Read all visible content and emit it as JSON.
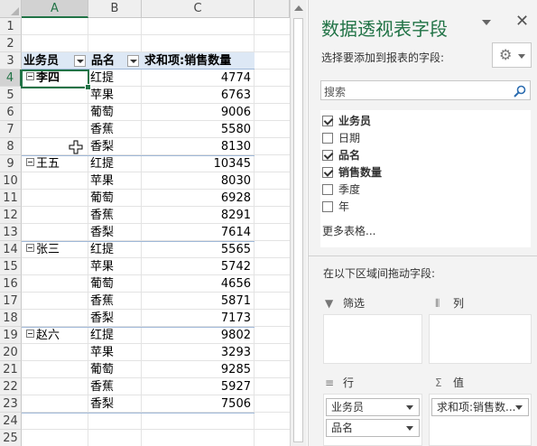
{
  "spreadsheet": {
    "columns": [
      "A",
      "B",
      "C"
    ],
    "selected_column": "A",
    "selected_row": "4",
    "row_numbers": [
      "1",
      "2",
      "3",
      "4",
      "5",
      "6",
      "7",
      "8",
      "9",
      "10",
      "11",
      "12",
      "13",
      "14",
      "15",
      "16",
      "17",
      "18",
      "19",
      "20",
      "21",
      "22",
      "23",
      "24",
      "25"
    ],
    "pivot_headers": {
      "a": "业务员",
      "b": "品名",
      "c": "求和项:销售数量"
    },
    "salespeople": [
      "李四",
      "王五",
      "张三",
      "赵六"
    ],
    "products": [
      "红提",
      "苹果",
      "葡萄",
      "香蕉",
      "香梨",
      "红提",
      "苹果",
      "葡萄",
      "香蕉",
      "香梨",
      "红提",
      "苹果",
      "葡萄",
      "香蕉",
      "香梨",
      "红提",
      "苹果",
      "葡萄",
      "香蕉",
      "香梨"
    ],
    "quantities": [
      "4774",
      "6763",
      "9006",
      "5580",
      "8130",
      "10345",
      "8030",
      "6928",
      "8291",
      "7614",
      "5565",
      "5742",
      "4656",
      "5871",
      "7173",
      "9802",
      "3293",
      "9285",
      "5927",
      "7506"
    ]
  },
  "pivot_pane": {
    "title": "数据透视表字段",
    "close_icon": "close-icon",
    "choose_fields_label": "选择要添加到报表的字段:",
    "search_placeholder": "搜索",
    "fields": [
      {
        "label": "业务员",
        "checked": true
      },
      {
        "label": "日期",
        "checked": false
      },
      {
        "label": "品名",
        "checked": true
      },
      {
        "label": "销售数量",
        "checked": true
      },
      {
        "label": "季度",
        "checked": false
      },
      {
        "label": "年",
        "checked": false
      }
    ],
    "more_tables": "更多表格...",
    "drag_label": "在以下区域间拖动字段:",
    "areas": {
      "filter": "筛选",
      "columns": "列",
      "rows": "行",
      "values": "值"
    },
    "row_chips": [
      "业务员",
      "品名"
    ],
    "value_chips": [
      "求和项:销售数..."
    ]
  },
  "colors": {
    "accent": "#217346",
    "header_band": "#dde8f5"
  }
}
